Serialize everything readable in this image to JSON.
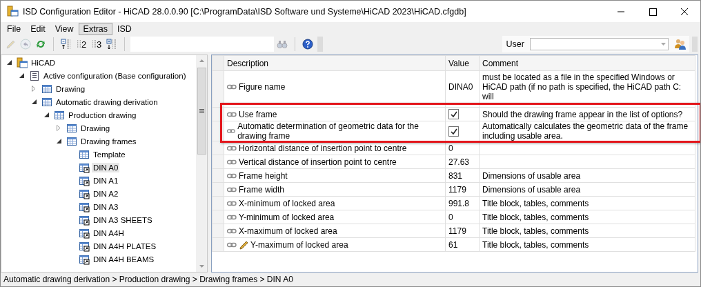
{
  "window": {
    "title": "ISD Configuration Editor  - HiCAD 28.0.0.90 [C:\\ProgramData\\ISD Software und Systeme\\HiCAD 2023\\HiCAD.cfgdb]"
  },
  "menu": [
    {
      "label": "File",
      "selected": false
    },
    {
      "label": "Edit",
      "selected": false
    },
    {
      "label": "View",
      "selected": false
    },
    {
      "label": "Extras",
      "selected": true
    },
    {
      "label": "ISD",
      "selected": false
    }
  ],
  "toolbar": [
    {
      "kind": "edit",
      "disabled": true
    },
    {
      "kind": "undo",
      "disabled": true
    },
    {
      "kind": "refresh",
      "disabled": false
    },
    {
      "kind": "sep"
    },
    {
      "kind": "collapse",
      "disabled": false
    },
    {
      "kind": "level",
      "label": "2",
      "disabled": false
    },
    {
      "kind": "level",
      "label": "3",
      "disabled": false
    },
    {
      "kind": "expand",
      "disabled": false
    },
    {
      "kind": "sep"
    },
    {
      "kind": "gap"
    },
    {
      "kind": "find",
      "disabled": true
    },
    {
      "kind": "sep"
    },
    {
      "kind": "help",
      "disabled": false
    }
  ],
  "user": {
    "label": "User"
  },
  "tree": [
    {
      "label": "HiCAD",
      "kind": "root",
      "expanded": true,
      "selected": false,
      "children": [
        {
          "label": "Active configuration (Base configuration)",
          "kind": "config",
          "expanded": true,
          "selected": false,
          "children": [
            {
              "label": "Drawing",
              "kind": "table",
              "expanded": false,
              "selected": false
            },
            {
              "label": "Automatic drawing derivation",
              "kind": "table",
              "expanded": true,
              "selected": false,
              "children": [
                {
                  "label": "Production drawing",
                  "kind": "table",
                  "expanded": true,
                  "selected": false,
                  "children": [
                    {
                      "label": "Drawing",
                      "kind": "table",
                      "expanded": false,
                      "selected": false
                    },
                    {
                      "label": "Drawing frames",
                      "kind": "table",
                      "expanded": true,
                      "selected": false,
                      "children": [
                        {
                          "label": "Template",
                          "kind": "table",
                          "selected": false
                        },
                        {
                          "label": "DIN A0",
                          "kind": "link",
                          "selected": true
                        },
                        {
                          "label": "DIN A1",
                          "kind": "link",
                          "selected": false
                        },
                        {
                          "label": "DIN A2",
                          "kind": "link",
                          "selected": false
                        },
                        {
                          "label": "DIN A3",
                          "kind": "link",
                          "selected": false
                        },
                        {
                          "label": "DIN A3 SHEETS",
                          "kind": "link",
                          "selected": false
                        },
                        {
                          "label": "DIN A4H",
                          "kind": "link",
                          "selected": false
                        },
                        {
                          "label": "DIN A4H PLATES",
                          "kind": "link",
                          "selected": false
                        },
                        {
                          "label": "DIN A4H BEAMS",
                          "kind": "link",
                          "selected": false
                        }
                      ]
                    }
                  ]
                }
              ]
            }
          ]
        }
      ]
    }
  ],
  "grid": {
    "columns": [
      "Description",
      "Value",
      "Comment"
    ],
    "rows": [
      {
        "description": "Figure name",
        "kind": "text",
        "value": "DINA0",
        "comment": "must be located as a file in the specified Windows or HiCAD path (if no path is specified, the HiCAD path C: will",
        "edited": false,
        "highlighted": false
      },
      {
        "description": "Use frame",
        "kind": "check",
        "checked": true,
        "comment": "Should the drawing frame appear in the list of options?",
        "edited": false,
        "highlighted": true
      },
      {
        "description": "Automatic determination of geometric data for the drawing frame",
        "kind": "check",
        "checked": true,
        "comment": "Automatically calculates the geometric data of the frame including usable area.",
        "edited": false,
        "highlighted": true
      },
      {
        "description": "Horizontal distance of insertion point to centre",
        "kind": "text",
        "value": "0",
        "edited": false,
        "highlighted": false
      },
      {
        "description": "Vertical distance of insertion point to centre",
        "kind": "text",
        "value": "27.63",
        "edited": false,
        "highlighted": false
      },
      {
        "description": "Frame height",
        "kind": "text",
        "value": "831",
        "comment": "Dimensions of usable area",
        "edited": false,
        "highlighted": false
      },
      {
        "description": "Frame width",
        "kind": "text",
        "value": "1179",
        "comment": "Dimensions of usable area",
        "edited": false,
        "highlighted": false
      },
      {
        "description": "X-minimum of locked area",
        "kind": "text",
        "value": "991.8",
        "comment": "Title block, tables, comments",
        "edited": false,
        "highlighted": false
      },
      {
        "description": "Y-minimum of locked area",
        "kind": "text",
        "value": "0",
        "comment": "Title block, tables, comments",
        "edited": false,
        "highlighted": false
      },
      {
        "description": "X-maximum of locked area",
        "kind": "text",
        "value": "1179",
        "comment": "Title block, tables, comments",
        "edited": false,
        "highlighted": false
      },
      {
        "description": "Y-maximum of locked area",
        "kind": "text",
        "value": "61",
        "comment": "Title block, tables, comments",
        "edited": true,
        "highlighted": false
      }
    ]
  },
  "status_bar": {
    "text": "Automatic drawing derivation > Production drawing > Drawing frames > DIN A0"
  }
}
